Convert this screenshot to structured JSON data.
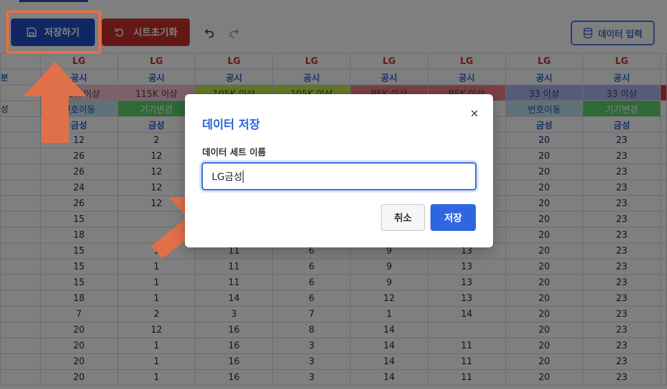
{
  "toolbar": {
    "save_label": "저장하기",
    "reset_label": "시트초기화",
    "data_input_label": "데이터 입력"
  },
  "grid": {
    "header_brand": [
      "LG",
      "LG",
      "LG",
      "LG",
      "LG",
      "LG",
      "LG",
      "LG"
    ],
    "header_label": [
      "공시",
      "공시",
      "공시",
      "공시",
      "공시",
      "공시",
      "공시",
      "공시"
    ],
    "header_desc": [
      "115K 이상",
      "115K 이상",
      "105K 이상",
      "105K 이상",
      "95K 이상",
      "95K 이상",
      "33 이상",
      "33 이상"
    ],
    "header_type": [
      "번호이동",
      "기기변경",
      "",
      "",
      "",
      "",
      "번호이동",
      "기기변경"
    ],
    "header_sub": [
      "금성",
      "금성",
      "",
      "",
      "",
      "",
      "금성",
      "금성"
    ],
    "row_labels": [
      "분",
      "",
      "",
      "성"
    ],
    "rows": [
      [
        "12",
        "2",
        "",
        "",
        "",
        "",
        "20",
        "23"
      ],
      [
        "26",
        "12",
        "",
        "",
        "",
        "",
        "20",
        "23"
      ],
      [
        "26",
        "12",
        "",
        "",
        "",
        "",
        "20",
        "23"
      ],
      [
        "24",
        "12",
        "",
        "",
        "",
        "",
        "20",
        "23"
      ],
      [
        "26",
        "12",
        "",
        "",
        "",
        "",
        "20",
        "23"
      ],
      [
        "15",
        "",
        "",
        "",
        "",
        "",
        "20",
        "23"
      ],
      [
        "18",
        "",
        "",
        "",
        "",
        "",
        "20",
        "23"
      ],
      [
        "15",
        "1",
        "11",
        "6",
        "9",
        "13",
        "20",
        "23"
      ],
      [
        "15",
        "1",
        "11",
        "6",
        "9",
        "13",
        "20",
        "23"
      ],
      [
        "15",
        "1",
        "11",
        "6",
        "9",
        "13",
        "20",
        "23"
      ],
      [
        "18",
        "1",
        "14",
        "6",
        "12",
        "13",
        "20",
        "23"
      ],
      [
        "7",
        "2",
        "3",
        "7",
        "1",
        "14",
        "20",
        "23"
      ],
      [
        "20",
        "12",
        "16",
        "8",
        "14",
        "",
        "20",
        "23"
      ],
      [
        "20",
        "1",
        "16",
        "3",
        "14",
        "11",
        "20",
        "23"
      ],
      [
        "20",
        "1",
        "16",
        "3",
        "14",
        "11",
        "20",
        "23"
      ],
      [
        "20",
        "1",
        "16",
        "3",
        "14",
        "11",
        "20",
        "23"
      ]
    ]
  },
  "dialog": {
    "title": "데이터 저장",
    "field_label": "데이터 세트 이름",
    "input_value": "LG금성",
    "cancel_label": "취소",
    "save_label": "저장",
    "close_icon": "×"
  },
  "colors": {
    "primary": "#2f66e0",
    "danger": "#c9302c",
    "highlight": "#e0704a"
  }
}
